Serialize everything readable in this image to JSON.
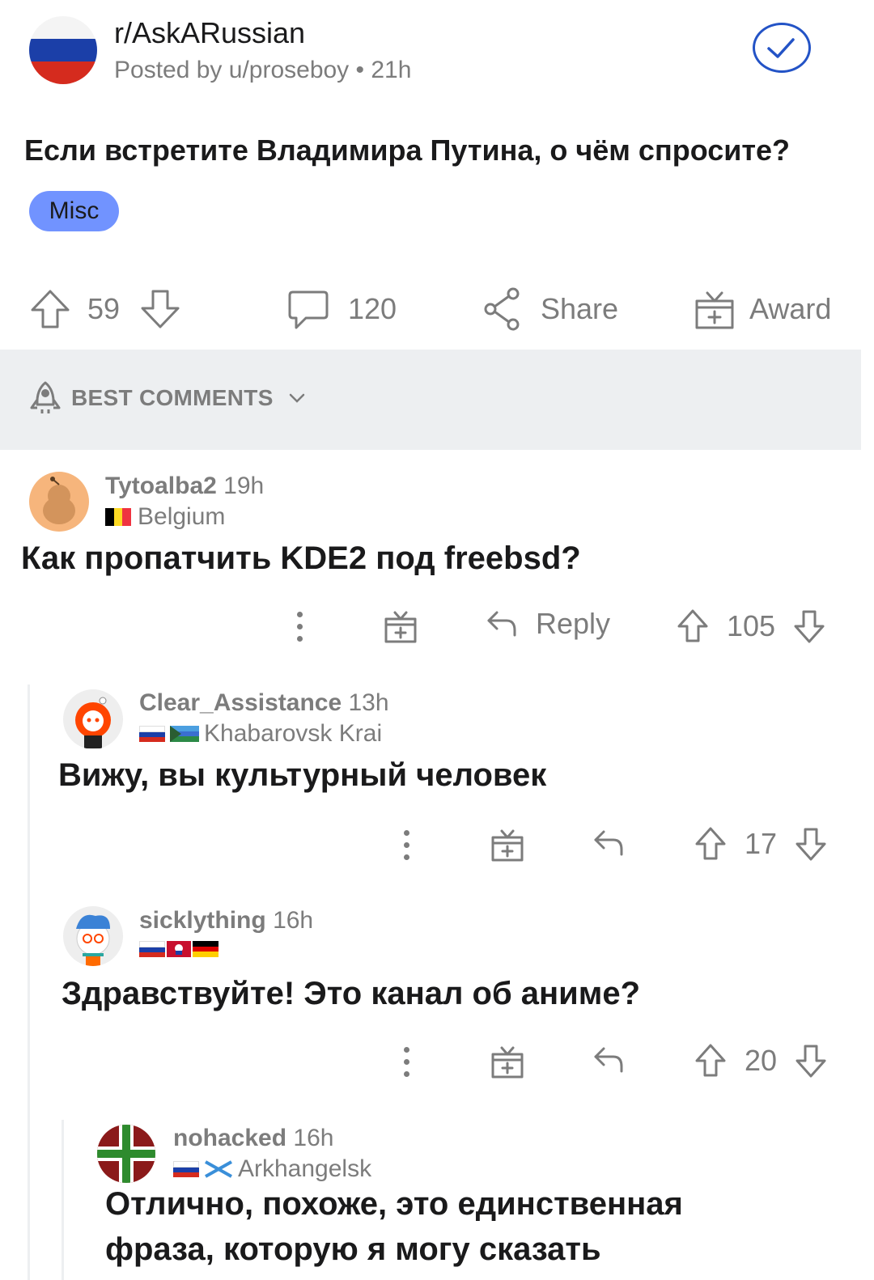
{
  "post": {
    "subreddit": "r/AskARussian",
    "posted_by": "Posted by u/proseboy • 21h",
    "title": "Если встретите Владимира Путина, о чём спросите?",
    "flair": "Misc",
    "upvotes": "59",
    "comments_count": "120",
    "share_label": "Share",
    "award_label": "Award"
  },
  "sort": {
    "label": "BEST COMMENTS"
  },
  "comments": [
    {
      "username": "Tytoalba2",
      "time": "19h",
      "flair": "Belgium",
      "text": "Как пропатчить KDE2 под freebsd?",
      "reply_label": "Reply",
      "score": "105"
    },
    {
      "username": "Clear_Assistance",
      "time": "13h",
      "flair": "Khabarovsk Krai",
      "text": "Вижу, вы культурный человек",
      "score": "17"
    },
    {
      "username": "sicklything",
      "time": "16h",
      "text": "Здравствуйте! Это канал об аниме?",
      "score": "20"
    },
    {
      "username": "nohacked",
      "time": "16h",
      "flair": "Arkhangelsk",
      "text_line1": "Отлично, похоже, это единственная",
      "text_line2": "фраза, которую я могу сказать"
    }
  ],
  "colors": {
    "accent_blue": "#2353c6",
    "flair_bg": "#7193ff",
    "meta_gray": "#7c7c7c",
    "bar_bg": "#edeff1"
  },
  "icons": [
    "checkmark-icon",
    "upvote-icon",
    "downvote-icon",
    "comment-icon",
    "share-icon",
    "award-icon",
    "rocket-icon",
    "chevron-down-icon",
    "more-icon",
    "reply-icon"
  ]
}
